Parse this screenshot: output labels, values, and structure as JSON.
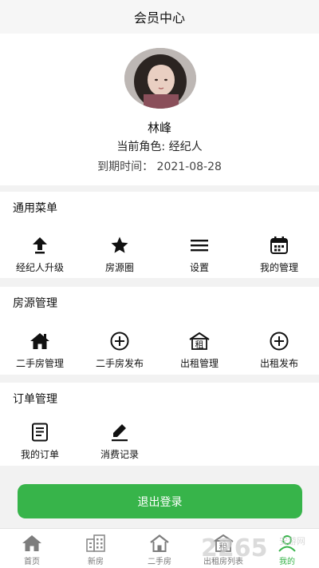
{
  "header": {
    "title": "会员中心"
  },
  "profile": {
    "name": "林峰",
    "role": "当前角色: 经纪人",
    "expire": "到期时间： 2021-08-28"
  },
  "general_menu": {
    "title": "通用菜单",
    "items": [
      {
        "label": "经纪人升级",
        "icon": "upload-arrow-icon"
      },
      {
        "label": "房源圈",
        "icon": "star-icon"
      },
      {
        "label": "设置",
        "icon": "menu-lines-icon"
      },
      {
        "label": "我的管理",
        "icon": "calendar-icon"
      }
    ]
  },
  "house_mgmt": {
    "title": "房源管理",
    "items": [
      {
        "label": "二手房管理",
        "icon": "house-icon"
      },
      {
        "label": "二手房发布",
        "icon": "plus-circle-icon"
      },
      {
        "label": "出租管理",
        "icon": "rent-house-icon",
        "glyph": "租"
      },
      {
        "label": "出租发布",
        "icon": "plus-circle-icon"
      }
    ]
  },
  "order_mgmt": {
    "title": "订单管理",
    "items": [
      {
        "label": "我的订单",
        "icon": "document-icon"
      },
      {
        "label": "消费记录",
        "icon": "edit-pen-icon"
      }
    ]
  },
  "logout": {
    "label": "退出登录"
  },
  "tabbar": {
    "items": [
      {
        "label": "首页",
        "icon": "home-icon"
      },
      {
        "label": "新房",
        "icon": "building-icon"
      },
      {
        "label": "二手房",
        "icon": "house-icon"
      },
      {
        "label": "出租房列表",
        "icon": "rent-icon",
        "glyph": "租"
      },
      {
        "label": "我的",
        "icon": "person-icon",
        "active": true
      }
    ]
  },
  "watermark": {
    "text": "2265",
    "suffix": "安游网"
  },
  "colors": {
    "accent": "#37b44a",
    "icon": "#111111",
    "tab_inactive": "#8a8a8a"
  }
}
